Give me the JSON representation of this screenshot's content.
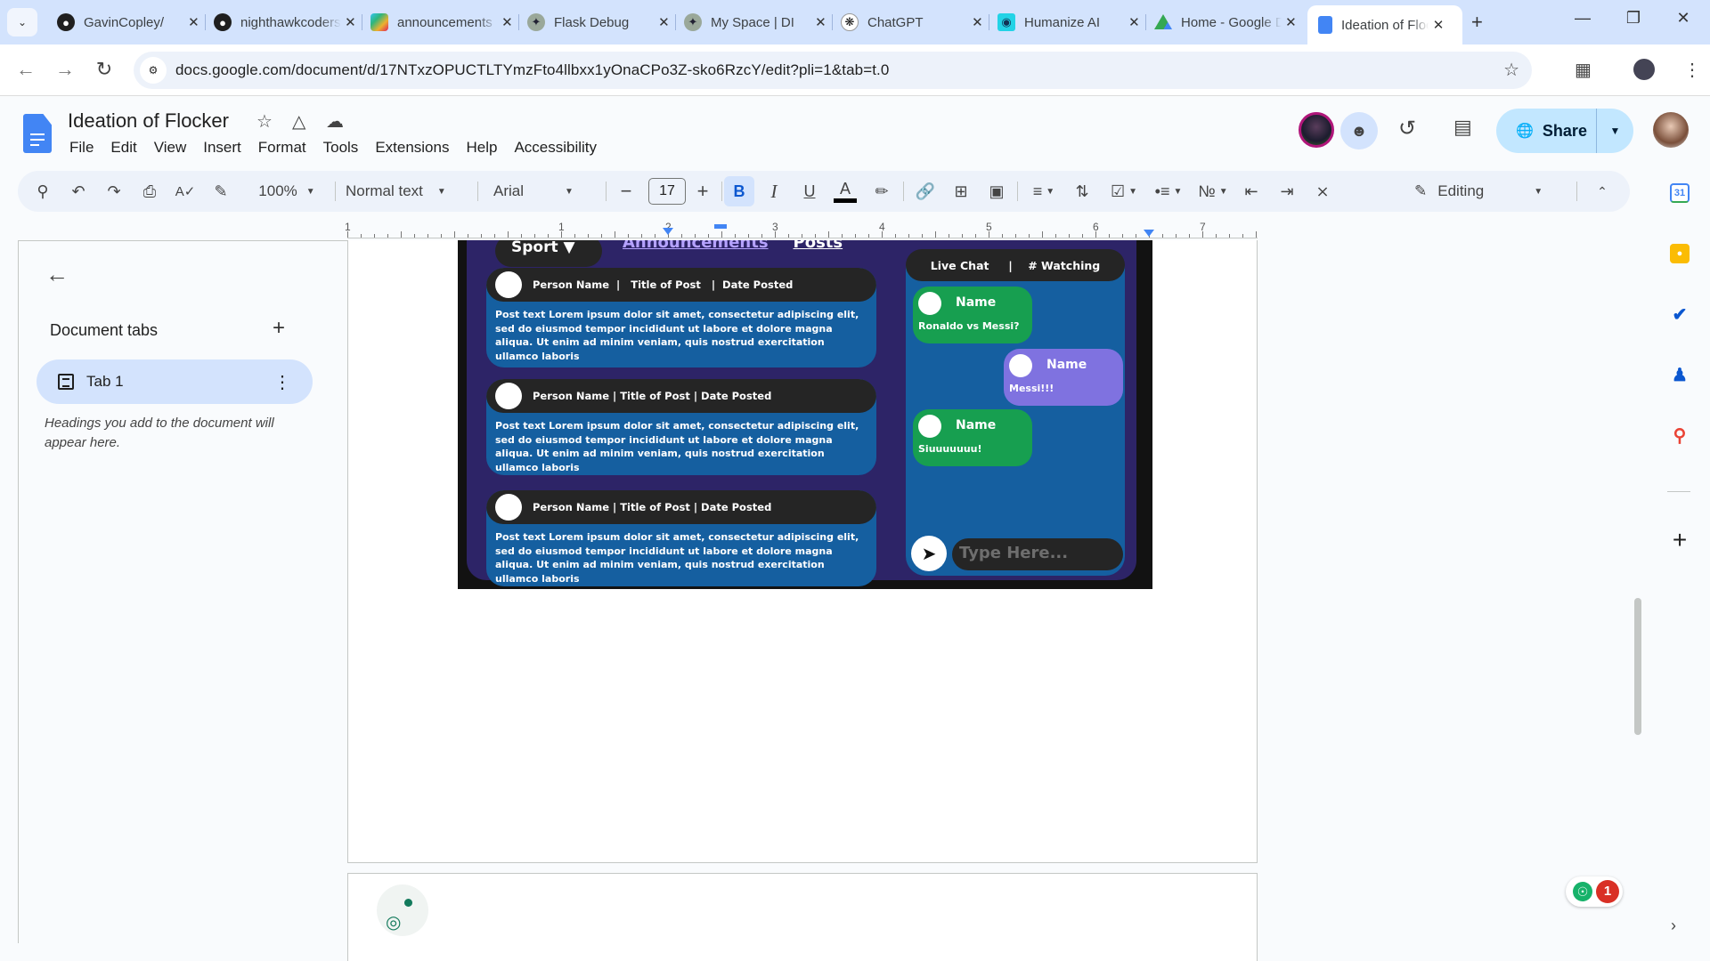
{
  "browser": {
    "tabs": [
      {
        "label": "GavinCopley/",
        "icon": "github-icon"
      },
      {
        "label": "nighthawkcoders",
        "icon": "github-icon"
      },
      {
        "label": "announcements",
        "icon": "slack-icon"
      },
      {
        "label": "Flask Debug",
        "icon": "bird-icon"
      },
      {
        "label": "My Space | DI",
        "icon": "bird-icon"
      },
      {
        "label": "ChatGPT",
        "icon": "chatgpt-icon"
      },
      {
        "label": "Humanize AI",
        "icon": "humanize-icon"
      },
      {
        "label": "Home - Google Drive",
        "icon": "drive-icon"
      },
      {
        "label": "Ideation of Flocker",
        "icon": "docs-icon",
        "active": true
      }
    ],
    "url": "docs.google.com/document/d/17NTxzOPUCTLTYmzFto4llbxx1yOnaCPo3Z-sko6RzcY/edit?pli=1&tab=t.0"
  },
  "doc": {
    "title": "Ideation of Flocker",
    "menu": [
      "File",
      "Edit",
      "View",
      "Insert",
      "Format",
      "Tools",
      "Extensions",
      "Help",
      "Accessibility"
    ],
    "share_label": "Share"
  },
  "toolbar": {
    "zoom": "100%",
    "style": "Normal text",
    "font": "Arial",
    "font_size": "17",
    "mode": "Editing"
  },
  "ruler": {
    "numbers": [
      "1",
      "1",
      "2",
      "3",
      "4",
      "5",
      "6",
      "7"
    ]
  },
  "sidebar": {
    "heading": "Document tabs",
    "tabs": [
      {
        "label": "Tab 1"
      }
    ],
    "hint": "Headings you add to the document will appear here."
  },
  "mockup": {
    "sport_label": "Sport",
    "nav_announcements": "Announcements",
    "nav_posts": "Posts",
    "posts": [
      {
        "header": "Person Name  |   Title of Post   |  Date Posted",
        "body": "Post text Lorem ipsum dolor sit amet, consectetur adipiscing elit, sed do eiusmod tempor incididunt ut labore et dolore magna aliqua. Ut enim ad minim veniam, quis nostrud exercitation ullamco laboris"
      },
      {
        "header": "Person Name | Title of Post | Date Posted",
        "body": "Post text  Lorem ipsum dolor sit amet, consectetur adipiscing elit, sed do eiusmod tempor incididunt ut labore et dolore magna aliqua. Ut enim ad minim veniam, quis nostrud exercitation ullamco laboris"
      },
      {
        "header": "Person Name | Title of Post | Date Posted",
        "body": "Post text  Lorem ipsum dolor sit amet, consectetur adipiscing elit, sed do eiusmod tempor incididunt ut labore et dolore magna aliqua. Ut enim ad minim veniam, quis nostrud exercitation ullamco laboris"
      }
    ],
    "chat_header": "Live Chat     |    # Watching",
    "messages": [
      {
        "name": "Name",
        "text": "Ronaldo vs Messi?",
        "color": "#179f50"
      },
      {
        "name": "Name",
        "text": "Messi!!!",
        "color": "#7f72e0"
      },
      {
        "name": "Name",
        "text": "Siuuuuuuu!",
        "color": "#179f50"
      }
    ],
    "input_placeholder": "Type  Here..."
  },
  "notifications": {
    "count": "1"
  },
  "colors": {
    "accent": "#0b57d0",
    "share_bg": "#c2e7ff",
    "tab_active_bg": "#d3e3fd"
  }
}
